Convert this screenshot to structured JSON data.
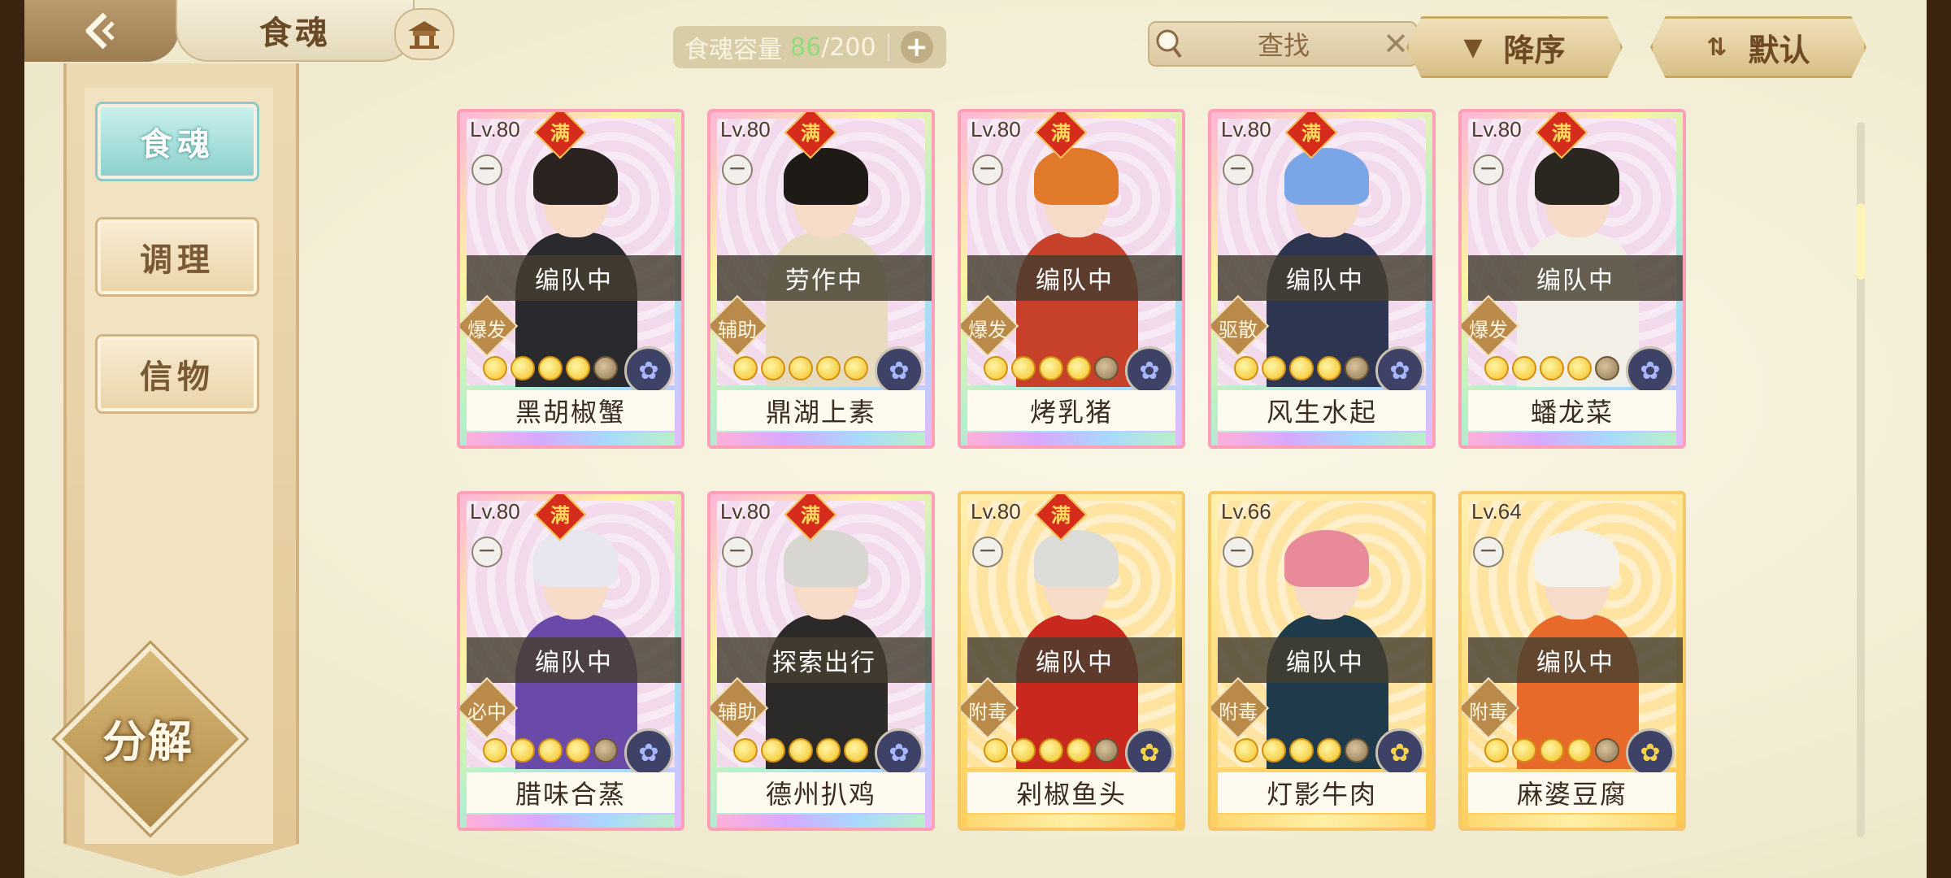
{
  "header": {
    "title": "食魂",
    "capacity_label": "食魂容量",
    "capacity_current": "86",
    "capacity_max": "/200",
    "capacity_add": "+",
    "search_placeholder": "查找",
    "search_clear": "✕",
    "sort_order": "降序",
    "sort_mode": "默认"
  },
  "sidebar": {
    "tabs": [
      {
        "label": "食魂",
        "active": true
      },
      {
        "label": "调理",
        "active": false
      },
      {
        "label": "信物",
        "active": false
      }
    ],
    "decompose_label": "分解"
  },
  "cards": [
    {
      "level": "Lv.80",
      "maxed": "满",
      "status": "编队中",
      "role": "爆发",
      "name": "黑胡椒蟹",
      "frame": "rainbow",
      "stars": 4,
      "emblem": "blue",
      "hair": "#2b2320",
      "outfit": "#2a2a2e"
    },
    {
      "level": "Lv.80",
      "maxed": "满",
      "status": "劳作中",
      "role": "辅助",
      "name": "鼎湖上素",
      "frame": "rainbow",
      "stars": 5,
      "emblem": "blue",
      "hair": "#1e1a16",
      "outfit": "#e8dcc0"
    },
    {
      "level": "Lv.80",
      "maxed": "满",
      "status": "编队中",
      "role": "爆发",
      "name": "烤乳猪",
      "frame": "rainbow",
      "stars": 4,
      "emblem": "blue",
      "hair": "#e07a2a",
      "outfit": "#c6402a"
    },
    {
      "level": "Lv.80",
      "maxed": "满",
      "status": "编队中",
      "role": "驱散",
      "name": "风生水起",
      "frame": "rainbow",
      "stars": 4,
      "emblem": "blue",
      "hair": "#7aa6e8",
      "outfit": "#2d3550"
    },
    {
      "level": "Lv.80",
      "maxed": "满",
      "status": "编队中",
      "role": "爆发",
      "name": "蟠龙菜",
      "frame": "rainbow",
      "stars": 4,
      "emblem": "blue",
      "hair": "#2a2620",
      "outfit": "#f2efe6"
    },
    {
      "level": "Lv.80",
      "maxed": "满",
      "status": "编队中",
      "role": "必中",
      "name": "腊味合蒸",
      "frame": "rainbow",
      "stars": 4,
      "emblem": "blue",
      "hair": "#e8e6ef",
      "outfit": "#6a4aa8"
    },
    {
      "level": "Lv.80",
      "maxed": "满",
      "status": "探索出行",
      "role": "辅助",
      "name": "德州扒鸡",
      "frame": "rainbow",
      "stars": 5,
      "emblem": "blue",
      "hair": "#d8d6d0",
      "outfit": "#2c2a28"
    },
    {
      "level": "Lv.80",
      "maxed": "满",
      "status": "编队中",
      "role": "附毒",
      "name": "剁椒鱼头",
      "frame": "gold",
      "stars": 4,
      "emblem": "gold",
      "hair": "#dcdcd8",
      "outfit": "#c8281e"
    },
    {
      "level": "Lv.66",
      "maxed": "",
      "status": "编队中",
      "role": "附毒",
      "name": "灯影牛肉",
      "frame": "gold",
      "stars": 4,
      "emblem": "gold",
      "hair": "#e88a9a",
      "outfit": "#1f3a4a"
    },
    {
      "level": "Lv.64",
      "maxed": "",
      "status": "编队中",
      "role": "附毒",
      "name": "麻婆豆腐",
      "frame": "gold",
      "stars": 4,
      "emblem": "gold",
      "hair": "#f4f0ea",
      "outfit": "#e86a2a"
    }
  ]
}
